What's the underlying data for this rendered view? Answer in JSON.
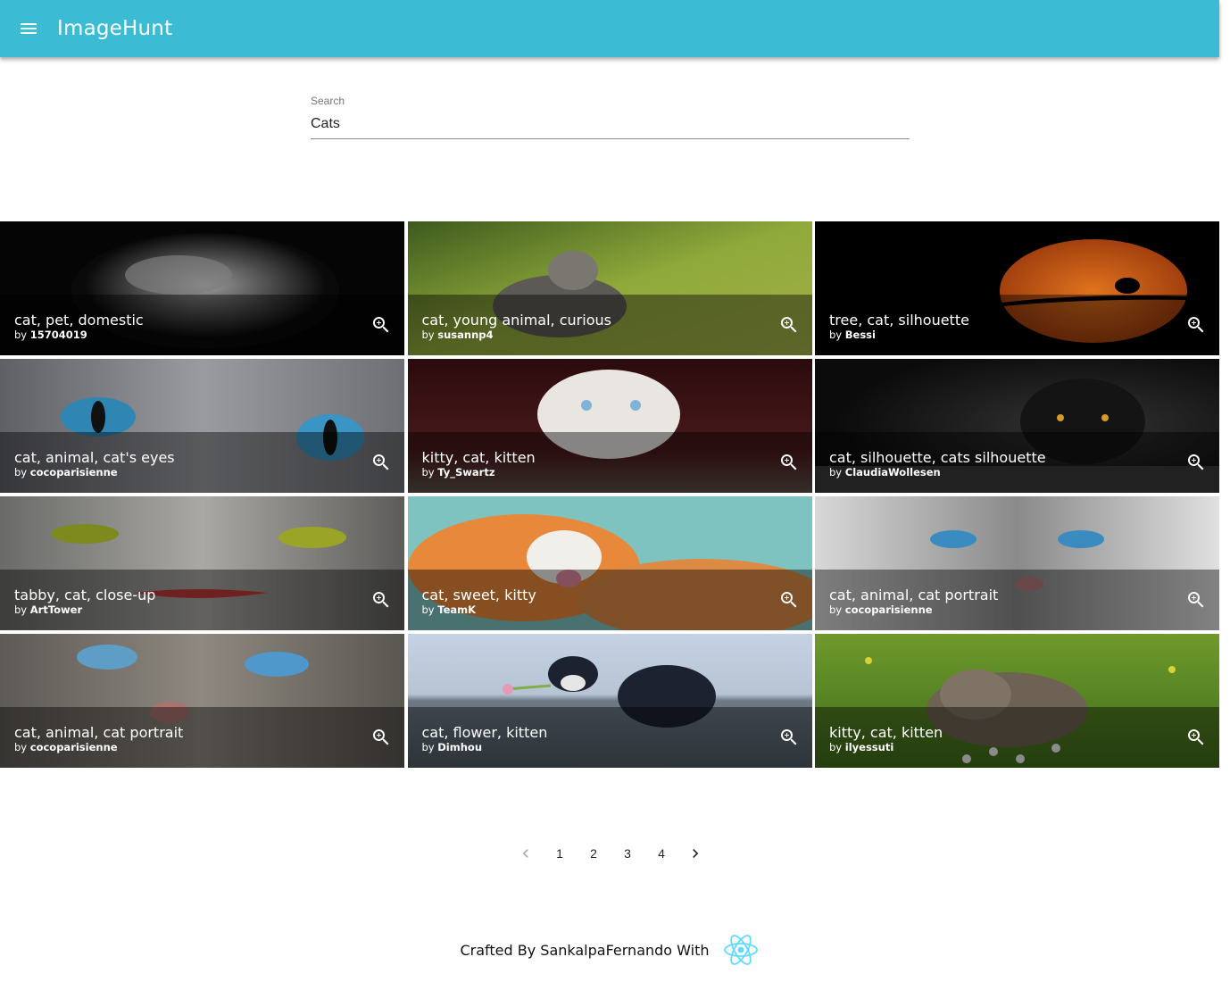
{
  "app": {
    "title": "ImageHunt"
  },
  "search": {
    "label": "Search",
    "value": "Cats"
  },
  "results": [
    {
      "tags": "cat, pet, domestic",
      "by": "by",
      "user": "15704019"
    },
    {
      "tags": "cat, young animal, curious",
      "by": "by",
      "user": "susannp4"
    },
    {
      "tags": "tree, cat, silhouette",
      "by": "by",
      "user": "Bessi"
    },
    {
      "tags": "cat, animal, cat's eyes",
      "by": "by",
      "user": "cocoparisienne"
    },
    {
      "tags": "kitty, cat, kitten",
      "by": "by",
      "user": "Ty_Swartz"
    },
    {
      "tags": "cat, silhouette, cats silhouette",
      "by": "by",
      "user": "ClaudiaWollesen"
    },
    {
      "tags": "tabby, cat, close-up",
      "by": "by",
      "user": "ArtTower"
    },
    {
      "tags": "cat, sweet, kitty",
      "by": "by",
      "user": "TeamK"
    },
    {
      "tags": "cat, animal, cat portrait",
      "by": "by",
      "user": "cocoparisienne"
    },
    {
      "tags": "cat, animal, cat portrait",
      "by": "by",
      "user": "cocoparisienne"
    },
    {
      "tags": "cat, flower, kitten",
      "by": "by",
      "user": "Dimhou"
    },
    {
      "tags": "kitty, cat, kitten",
      "by": "by",
      "user": "ilyessuti"
    }
  ],
  "pagination": {
    "pages": [
      "1",
      "2",
      "3",
      "4"
    ]
  },
  "footer": {
    "text": "Crafted By SankalpaFernando With"
  },
  "colors": {
    "appbar": "#3bbcd4",
    "react": "#61dafb"
  },
  "icons": {
    "menu": "menu-icon",
    "zoom": "zoom-in-icon",
    "prev": "chevron-left-icon",
    "next": "chevron-right-icon",
    "logo": "react-logo"
  }
}
